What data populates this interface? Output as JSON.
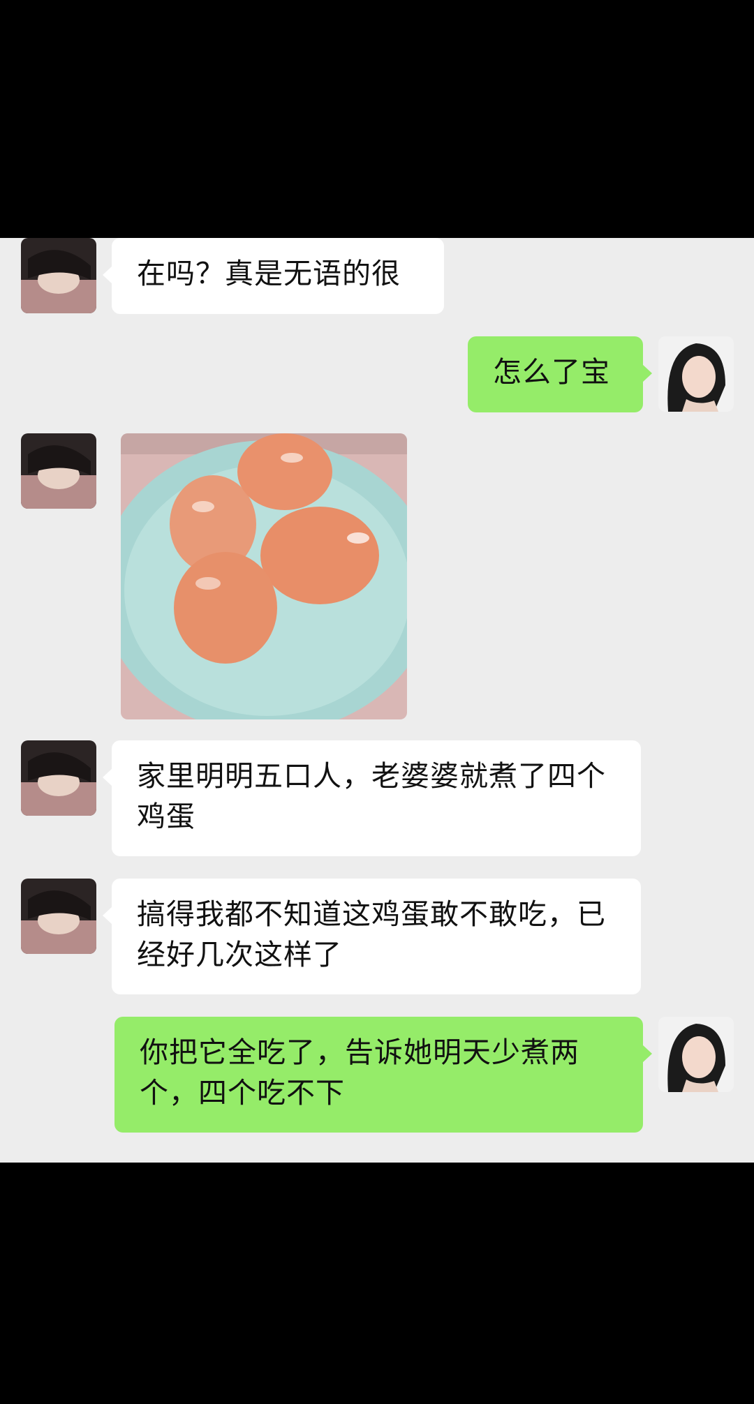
{
  "chat": {
    "messages": [
      {
        "id": 1,
        "direction": "incoming",
        "type": "text",
        "text": "在吗？真是无语的很"
      },
      {
        "id": 2,
        "direction": "outgoing",
        "type": "text",
        "text": "怎么了宝"
      },
      {
        "id": 3,
        "direction": "incoming",
        "type": "image",
        "image_subject": "four-boiled-eggs-on-plate"
      },
      {
        "id": 4,
        "direction": "incoming",
        "type": "text",
        "text": "家里明明五口人，老婆婆就煮了四个鸡蛋"
      },
      {
        "id": 5,
        "direction": "incoming",
        "type": "text",
        "text": "搞得我都不知道这鸡蛋敢不敢吃，已经好几次这样了"
      },
      {
        "id": 6,
        "direction": "outgoing",
        "type": "text",
        "text": "你把它全吃了，告诉她明天少煮两个，四个吃不下"
      }
    ]
  },
  "colors": {
    "chat_background": "#ededed",
    "incoming_bubble": "#ffffff",
    "outgoing_bubble": "#95ec69",
    "frame_background": "#000000"
  }
}
